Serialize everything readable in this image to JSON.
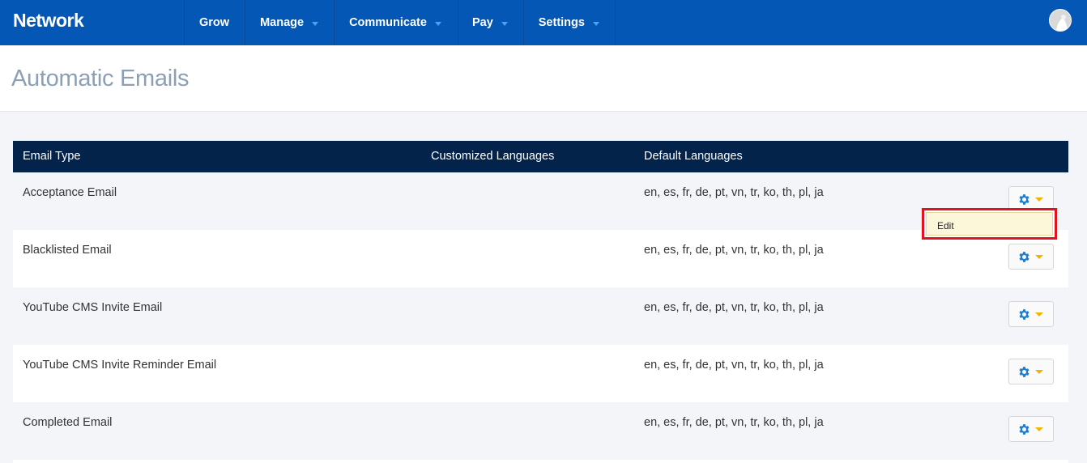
{
  "nav": {
    "brand": "Network",
    "items": [
      {
        "label": "Grow"
      },
      {
        "label": "Manage"
      },
      {
        "label": "Communicate"
      },
      {
        "label": "Pay"
      },
      {
        "label": "Settings"
      }
    ]
  },
  "page": {
    "title": "Automatic Emails"
  },
  "table": {
    "headers": {
      "type": "Email Type",
      "custom": "Customized Languages",
      "defaults": "Default Languages"
    },
    "rows": [
      {
        "type": "Acceptance Email",
        "custom": "",
        "defaults": "en, es, fr, de, pt, vn, tr, ko, th, pl, ja"
      },
      {
        "type": "Blacklisted Email",
        "custom": "",
        "defaults": "en, es, fr, de, pt, vn, tr, ko, th, pl, ja"
      },
      {
        "type": "YouTube CMS Invite Email",
        "custom": "",
        "defaults": "en, es, fr, de, pt, vn, tr, ko, th, pl, ja"
      },
      {
        "type": "YouTube CMS Invite Reminder Email",
        "custom": "",
        "defaults": "en, es, fr, de, pt, vn, tr, ko, th, pl, ja"
      },
      {
        "type": "Completed Email",
        "custom": "",
        "defaults": "en, es, fr, de, pt, vn, tr, ko, th, pl, ja"
      }
    ]
  },
  "dropdown": {
    "edit_label": "Edit"
  },
  "icons": {
    "row_action": "gear-icon",
    "row_action_caret": "caret-down-icon",
    "user": "avatar"
  },
  "colors": {
    "nav_bg": "#0557b5",
    "table_header_bg": "#03234b",
    "title_text": "#8c9fb4",
    "gear_icon": "#1a7fd6",
    "caret_accent": "#f0b400",
    "highlight_border": "#e3131e",
    "dropdown_item_bg": "#fdf7d9"
  }
}
